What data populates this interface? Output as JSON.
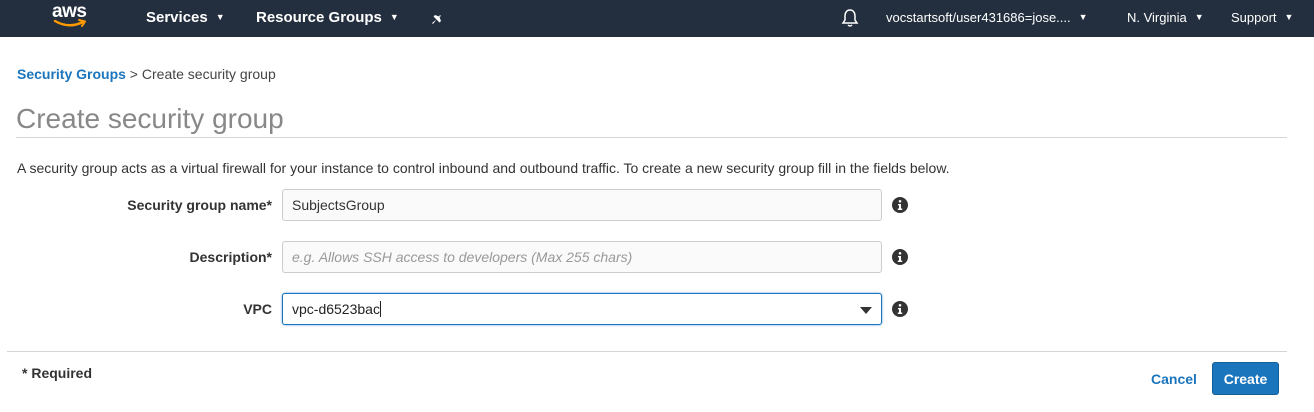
{
  "nav": {
    "logo_text": "aws",
    "services": "Services",
    "resource_groups": "Resource Groups",
    "account": "vocstartsoft/user431686=jose....",
    "region": "N. Virginia",
    "support": "Support",
    "icons": [
      "pin-icon",
      "bell-icon",
      "chevron-down-icon"
    ]
  },
  "breadcrumb": {
    "link": "Security Groups",
    "separator": " > ",
    "current": "Create security group"
  },
  "page": {
    "title": "Create security group",
    "intro": "A security group acts as a virtual firewall for your instance to control inbound and outbound traffic. To create a new security group fill in the fields below."
  },
  "form": {
    "name_label": "Security group name*",
    "name_value": "SubjectsGroup",
    "description_label": "Description*",
    "description_value": "",
    "description_placeholder": "e.g. Allows SSH access to developers (Max 255 chars)",
    "vpc_label": "VPC",
    "vpc_value": "vpc-d6523bac"
  },
  "footer": {
    "required_note": "* Required",
    "cancel_label": "Cancel",
    "create_label": "Create"
  },
  "colors": {
    "nav_bg": "#232f3e",
    "accent": "#1b75bc",
    "logo_smile": "#ff9900"
  }
}
